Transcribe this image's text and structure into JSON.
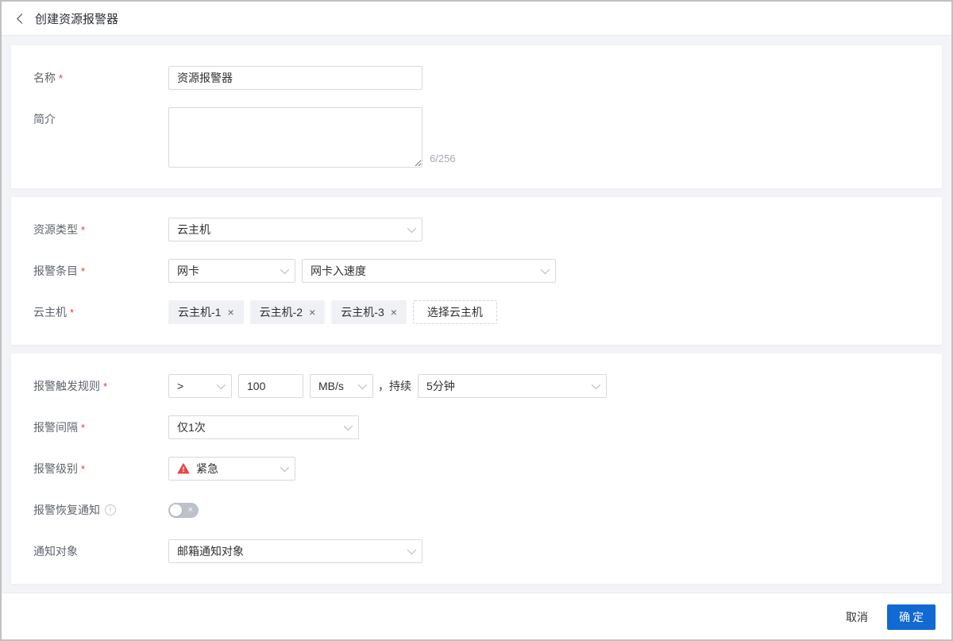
{
  "ui": {
    "required_mark": "*",
    "remove_icon": "×",
    "toggle_off_icon": "×",
    "info_icon": "i"
  },
  "header": {
    "title": "创建资源报警器"
  },
  "sections": {
    "basic": {
      "name_label": "名称",
      "name_value": "资源报警器",
      "intro_label": "简介",
      "intro_value": "",
      "counter": "6/256"
    },
    "resource": {
      "type_label": "资源类型",
      "type_value": "云主机",
      "entry_label": "报警条目",
      "entry_category": "网卡",
      "entry_metric": "网卡入速度",
      "host_label": "云主机",
      "host_tags": [
        "云主机-1",
        "云主机-2",
        "云主机-3"
      ],
      "select_host_button": "选择云主机"
    },
    "rule": {
      "trigger_label": "报警触发规则",
      "operator": ">",
      "threshold": "100",
      "unit": "MB/s",
      "duration_prefix": "，持续",
      "duration": "5分钟",
      "interval_label": "报警间隔",
      "interval_value": "仅1次",
      "level_label": "报警级别",
      "level_value": "紧急",
      "recovery_label": "报警恢复通知",
      "recovery_enabled": false,
      "notify_label": "通知对象",
      "notify_value": "邮箱通知对象"
    }
  },
  "footer": {
    "cancel": "取消",
    "confirm": "确定"
  },
  "colors": {
    "primary": "#1269d4",
    "danger": "#e84749",
    "required": "#f5313d",
    "page_bg": "#f3f4f8",
    "tag_bg": "#f0f1f5"
  }
}
